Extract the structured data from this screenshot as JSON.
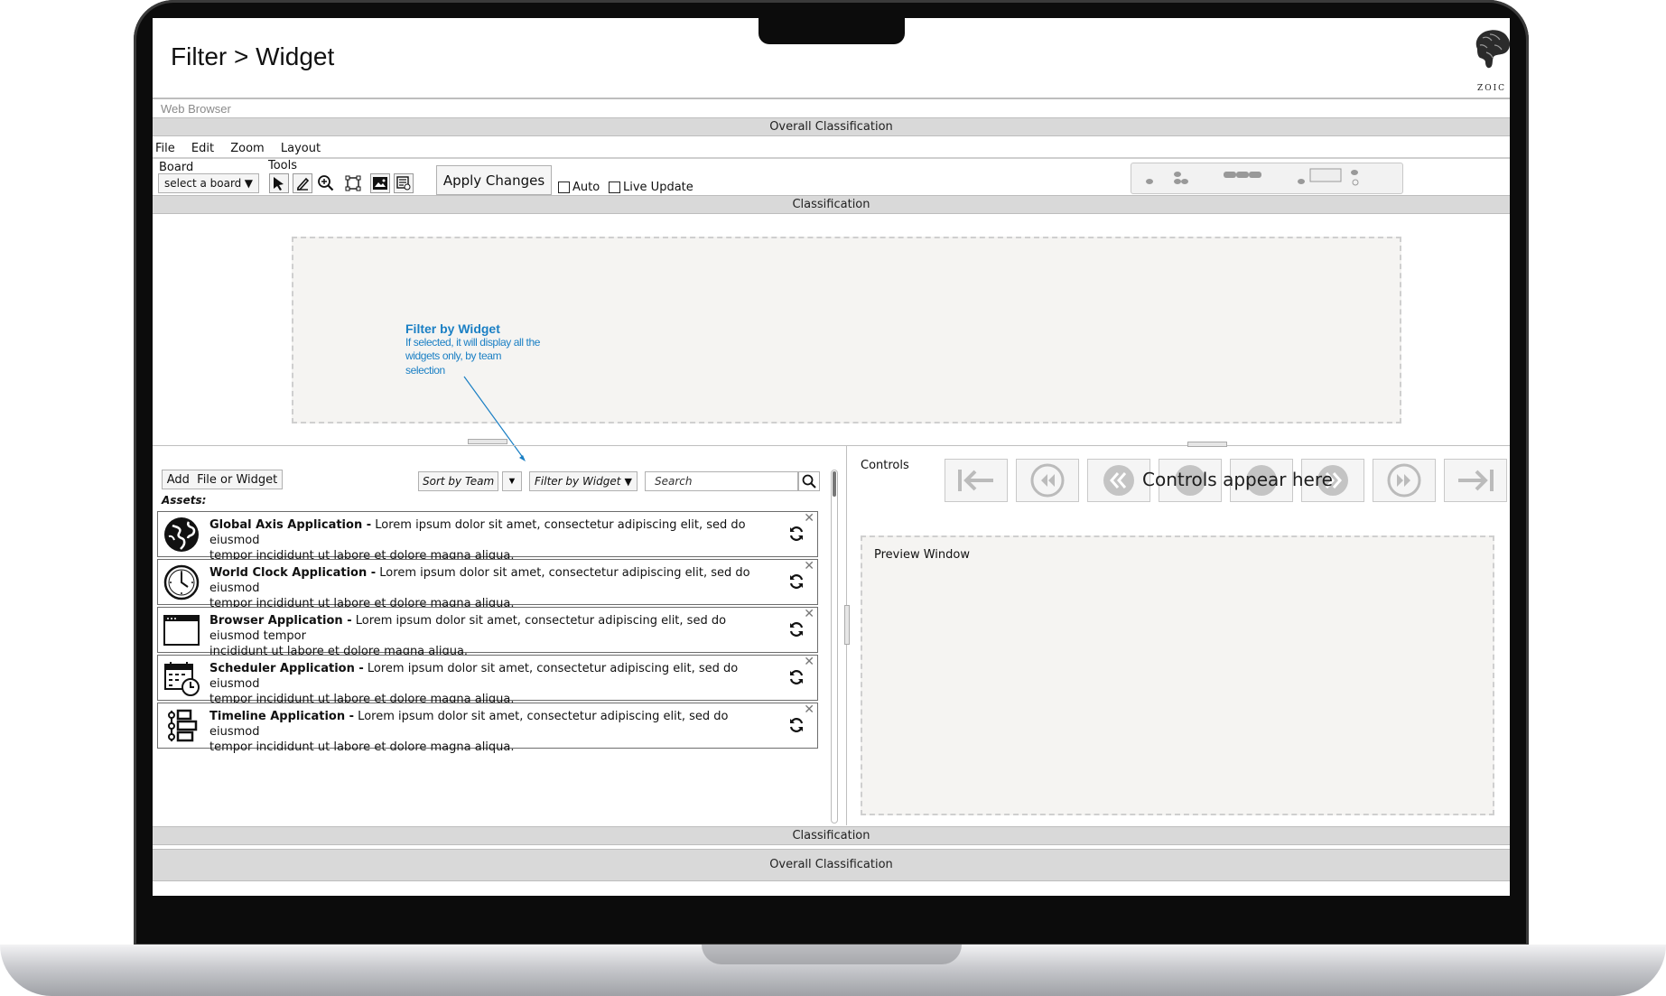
{
  "page": {
    "title": "Filter > Widget",
    "logo_text": "ZOIC",
    "browser_label": "Web Browser"
  },
  "classification": {
    "overall": "Overall Classification",
    "section": "Classification"
  },
  "menu": [
    "File",
    "Edit",
    "Zoom",
    "Layout"
  ],
  "toolbar": {
    "board_label": "Board",
    "tools_label": "Tools",
    "board_select_value": "select a board",
    "apply_label": "Apply Changes",
    "auto_label": "Auto",
    "live_update_label": "Live Update",
    "tool_icons": [
      "pointer-icon",
      "pen-icon",
      "zoom-icon",
      "transform-icon",
      "image-icon",
      "notes-icon"
    ]
  },
  "annotation": {
    "title": "Filter by Widget",
    "body_line1": "If selected, it will display all the",
    "body_line2": "widgets only, by team",
    "body_line3": "selection",
    "color": "#1a7fc4"
  },
  "assets": {
    "add_button": "Add  File or Widget",
    "sort_select": "Sort by Team",
    "filter_select": "Filter by Widget",
    "search_placeholder": "Search",
    "label": "Assets:",
    "items": [
      {
        "title": "Global Axis Application -",
        "desc_line1": " Lorem ipsum dolor sit amet, consectetur adipiscing elit, sed do eiusmod",
        "desc_line2": "tempor incididunt ut labore et dolore magna aliqua.",
        "icon": "globe-icon"
      },
      {
        "title": "World Clock Application -",
        "desc_line1": " Lorem ipsum dolor sit amet, consectetur adipiscing elit, sed do eiusmod",
        "desc_line2": "tempor incididunt ut labore et dolore magna aliqua.",
        "icon": "clock-icon"
      },
      {
        "title": "Browser Application -",
        "desc_line1": " Lorem ipsum dolor sit amet, consectetur adipiscing elit, sed do eiusmod tempor",
        "desc_line2": "incididunt ut labore et dolore magna aliqua.",
        "icon": "browser-window-icon"
      },
      {
        "title": "Scheduler Application -",
        "desc_line1": " Lorem ipsum dolor sit amet, consectetur adipiscing elit, sed do eiusmod",
        "desc_line2": "tempor incididunt ut labore et dolore magna aliqua.",
        "icon": "calendar-clock-icon"
      },
      {
        "title": "Timeline Application -",
        "desc_line1": " Lorem ipsum dolor sit amet, consectetur adipiscing elit, sed do eiusmod",
        "desc_line2": "tempor incididunt ut labore et dolore magna aliqua.",
        "icon": "timeline-icon"
      }
    ]
  },
  "controls": {
    "label": "Controls",
    "overlay_text": "Controls appear here",
    "buttons": [
      "skip-to-start-icon",
      "rewind-icon",
      "fast-backward-icon",
      "previous-icon",
      "play-icon",
      "fast-forward-icon",
      "forward-icon",
      "skip-to-end-icon"
    ]
  },
  "preview": {
    "label": "Preview Window"
  }
}
